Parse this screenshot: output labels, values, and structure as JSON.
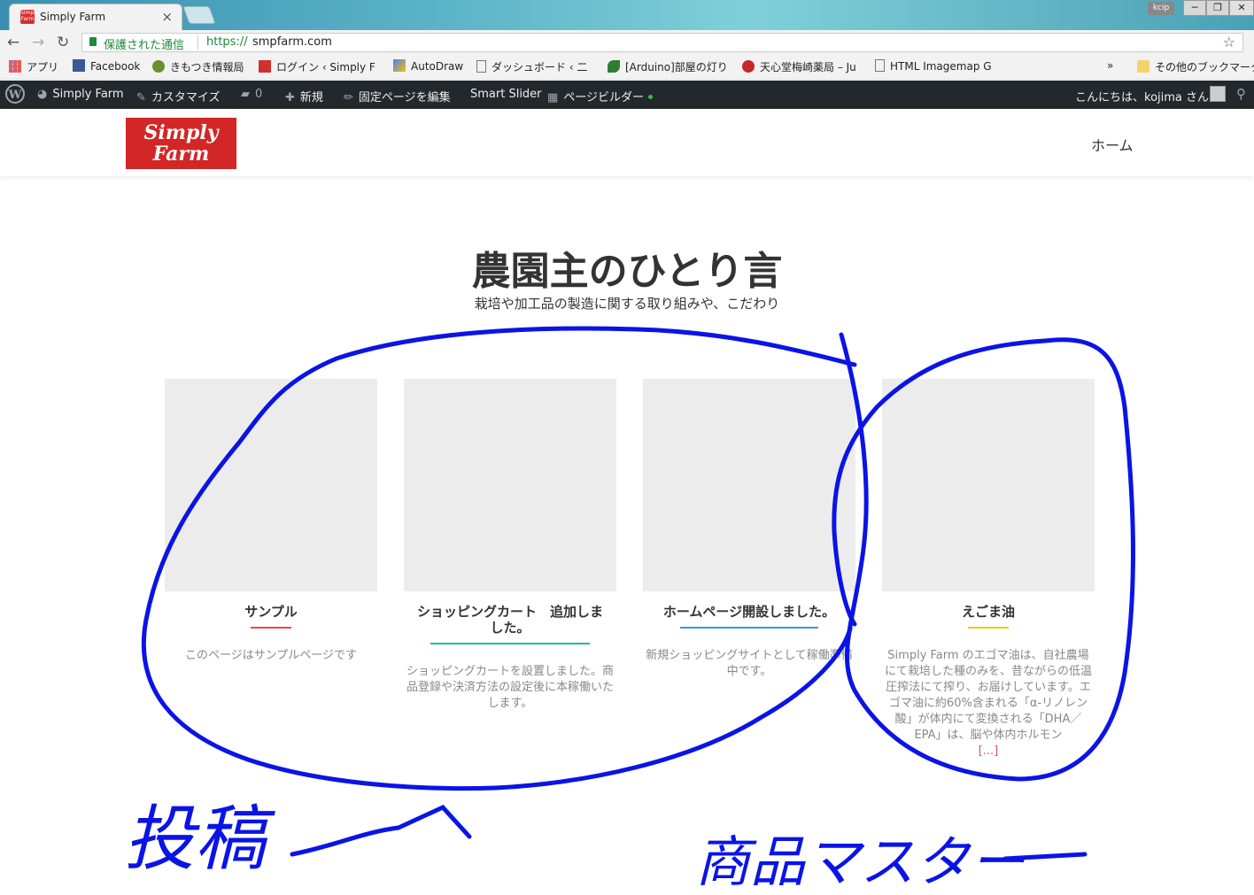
{
  "browser": {
    "tab_title": "Simply Farm",
    "tab_favicon_text": "Simply Farm",
    "close_symbol": "×",
    "profile": "kcip",
    "window_buttons": {
      "minimize": "─",
      "restore": "❐",
      "close": "✕"
    },
    "secure_label": "保護された通信",
    "url_scheme": "https://",
    "url_host": "smpfarm.com",
    "star_symbol": "☆",
    "nav": {
      "back": "←",
      "forward": "→",
      "reload": "↻"
    }
  },
  "bookmarks": {
    "items": [
      {
        "label": "アプリ",
        "icon": "apps-grid-icon"
      },
      {
        "label": "Facebook",
        "icon": "facebook-icon"
      },
      {
        "label": "きもつき情報局",
        "icon": "tree-icon"
      },
      {
        "label": "ログイン ‹ Simply F",
        "icon": "simplyfarm-icon"
      },
      {
        "label": "AutoDraw",
        "icon": "pencil-icon"
      },
      {
        "label": "ダッシュボード ‹ 二",
        "icon": "page-icon"
      },
      {
        "label": "[Arduino]部屋の灯り",
        "icon": "leaf-icon"
      },
      {
        "label": "天心堂梅崎薬局 – Ju",
        "icon": "character-icon"
      },
      {
        "label": "HTML Imagemap G",
        "icon": "page-icon"
      }
    ],
    "overflow": "»",
    "other": "その他のブックマーク"
  },
  "adminbar": {
    "site_name": "Simply Farm",
    "customize": "カスタマイズ",
    "comments_count": "0",
    "new": "新規",
    "edit_page": "固定ページを編集",
    "smart_slider": "Smart Slider",
    "page_builder": "ページビルダー",
    "greeting": "こんにちは、kojima さん"
  },
  "site": {
    "logo_line1": "Simply",
    "logo_line2": "Farm",
    "nav_home": "ホーム"
  },
  "section": {
    "title": "農園主のひとり言",
    "subtitle": "栽培や加工品の製造に関する取り組みや、こだわり"
  },
  "cards": [
    {
      "title": "サンプル",
      "excerpt": "このページはサンプルページです",
      "accent": "#e74c3c"
    },
    {
      "title": "ショッピングカート　追加しました。",
      "excerpt": "ショッピングカートを設置しました。商品登録や決済方法の設定後に本稼働いたします。",
      "accent": "#1abc9c"
    },
    {
      "title": "ホームページ開設しました。",
      "excerpt": "新規ショッピングサイトとして稼働準備中です。",
      "accent": "#3498db"
    },
    {
      "title": "えごま油",
      "excerpt": "Simply Farm のエゴマ油は、自社農場にて栽培した種のみを、昔ながらの低温圧搾法にて搾り、お届けしています。エゴマ油に約60%含まれる「α-リノレン酸」が体内にて変換される「DHA／EPA」は、脳や体内ホルモン",
      "more": "[...]",
      "accent": "#f1c40f"
    }
  ],
  "annotations": {
    "left_label": "投稿",
    "right_label": "商品マスター",
    "ink_color": "#0a14e6"
  }
}
